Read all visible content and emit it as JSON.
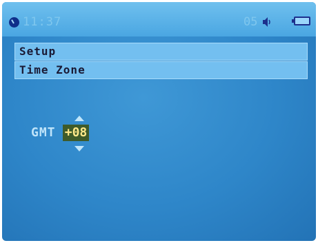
{
  "status": {
    "time": "11:37",
    "volume": "05"
  },
  "menu": {
    "items": [
      "Setup",
      "Time Zone"
    ]
  },
  "timezone": {
    "label": "GMT",
    "value": "+08"
  },
  "icons": {
    "clock": "clock-icon",
    "speaker": "speaker-icon",
    "battery": "battery-icon",
    "up": "arrow-up-icon",
    "down": "arrow-down-icon"
  }
}
